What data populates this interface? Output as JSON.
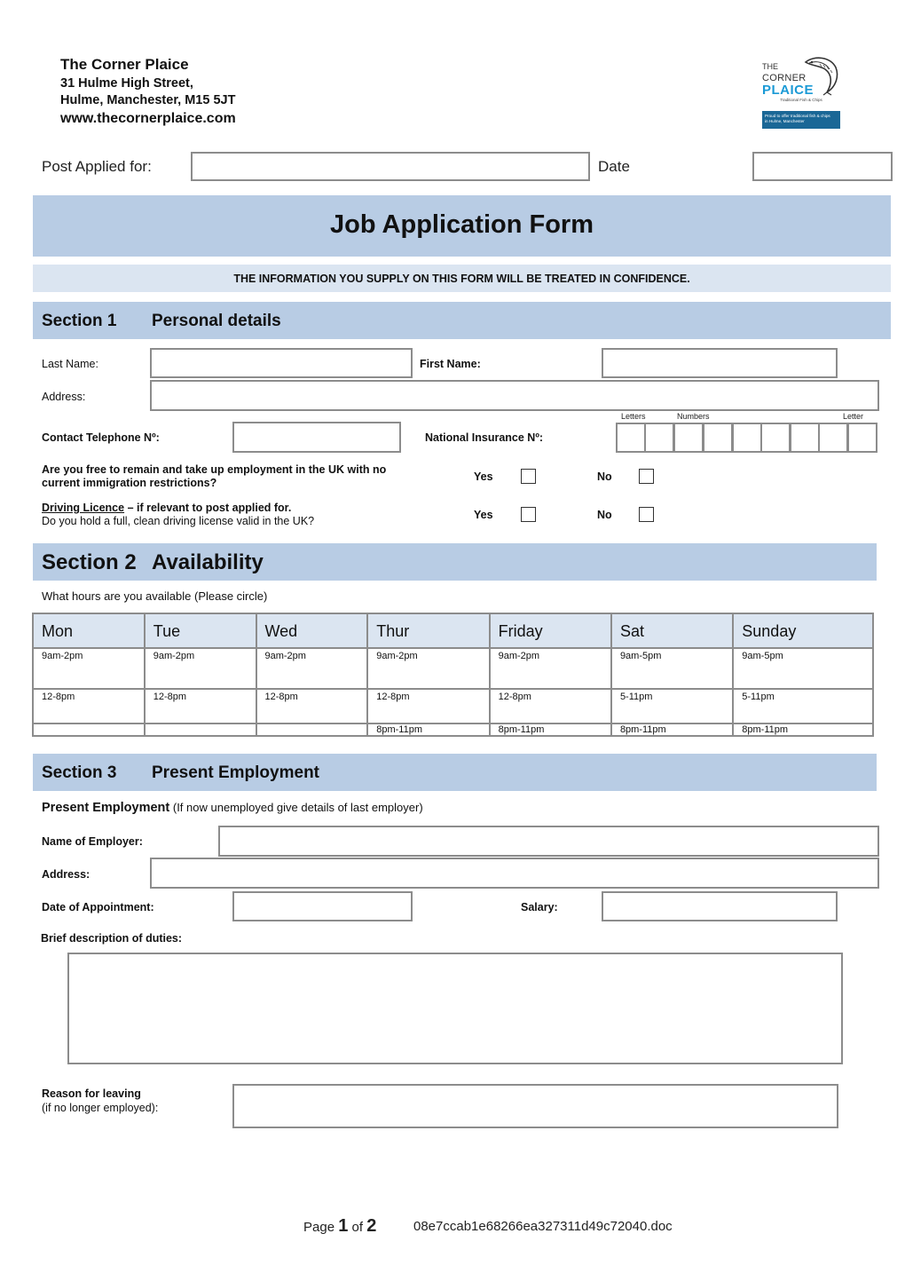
{
  "header": {
    "company_name": "The Corner Plaice",
    "address_line1": "31 Hulme High Street,",
    "address_line2": "Hulme, Manchester, M15 5JT",
    "website": "www.thecornerplaice.com",
    "logo": {
      "line1": "THE",
      "line2": "CORNER",
      "line3": "PLAICE",
      "tagline": "Traditional Fish & Chips",
      "badge_line1": "Proud to offer traditional fish & chips",
      "badge_line2": "in Hulme, Manchester",
      "brand_color": "#1b9ad6",
      "badge_color": "#1a6796"
    }
  },
  "top_fields": {
    "post_label": "Post Applied for:",
    "post_value": "",
    "date_label": "Date",
    "date_value": ""
  },
  "title": "Job Application Form",
  "confidential_notice": "THE INFORMATION YOU SUPPLY ON THIS FORM WILL BE TREATED IN CONFIDENCE.",
  "colors": {
    "section_bar": "#b8cce4",
    "light_bar": "#dbe5f1",
    "field_border": "#8c8c8c"
  },
  "section1": {
    "number": "Section 1",
    "title": "Personal details",
    "last_name_label": "Last Name:",
    "first_name_label": "First Name:",
    "address_label": "Address:",
    "telephone_label": "Contact Telephone Nº:",
    "ni_label": "National Insurance Nº:",
    "ni_hints": {
      "letters": "Letters",
      "numbers": "Numbers",
      "letter": "Letter"
    },
    "immigration_question_line1": "Are you free to remain and take up employment in the UK with no",
    "immigration_question_line2": "current immigration restrictions?",
    "driving_title": "Driving Licence",
    "driving_suffix": " – if relevant to post applied for.",
    "driving_question": "Do you hold a full, clean driving license valid in the UK?",
    "yes_label": "Yes",
    "no_label": "No"
  },
  "section2": {
    "number": "Section 2",
    "title": "Availability",
    "instruction": "What hours are you available (Please circle)",
    "days": [
      "Mon",
      "Tue",
      "Wed",
      "Thur",
      "Friday",
      "Sat",
      "Sunday"
    ],
    "rows": [
      [
        "9am-2pm",
        "9am-2pm",
        "9am-2pm",
        "9am-2pm",
        "9am-2pm",
        "9am-5pm",
        "9am-5pm"
      ],
      [
        "12-8pm",
        "12-8pm",
        "12-8pm",
        "12-8pm",
        "12-8pm",
        "5-11pm",
        "5-11pm"
      ],
      [
        "",
        "",
        "",
        "8pm-11pm",
        "8pm-11pm",
        "8pm-11pm",
        "8pm-11pm"
      ]
    ]
  },
  "section3": {
    "number": "Section 3",
    "title": "Present Employment",
    "intro_bold": "Present Employment",
    "intro_rest": " (If now unemployed give details of last employer)",
    "employer_label": "Name of Employer:",
    "address_label": "Address:",
    "appointment_label": "Date of Appointment:",
    "salary_label": "Salary:",
    "duties_label": "Brief description of duties:",
    "reason_label": "Reason for leaving",
    "reason_sub": "(if no longer employed):"
  },
  "footer": {
    "page_word": "Page",
    "page_current": "1",
    "of_word": "of",
    "page_total": "2",
    "filename": "08e7ccab1e68266ea327311d49c72040.doc"
  }
}
